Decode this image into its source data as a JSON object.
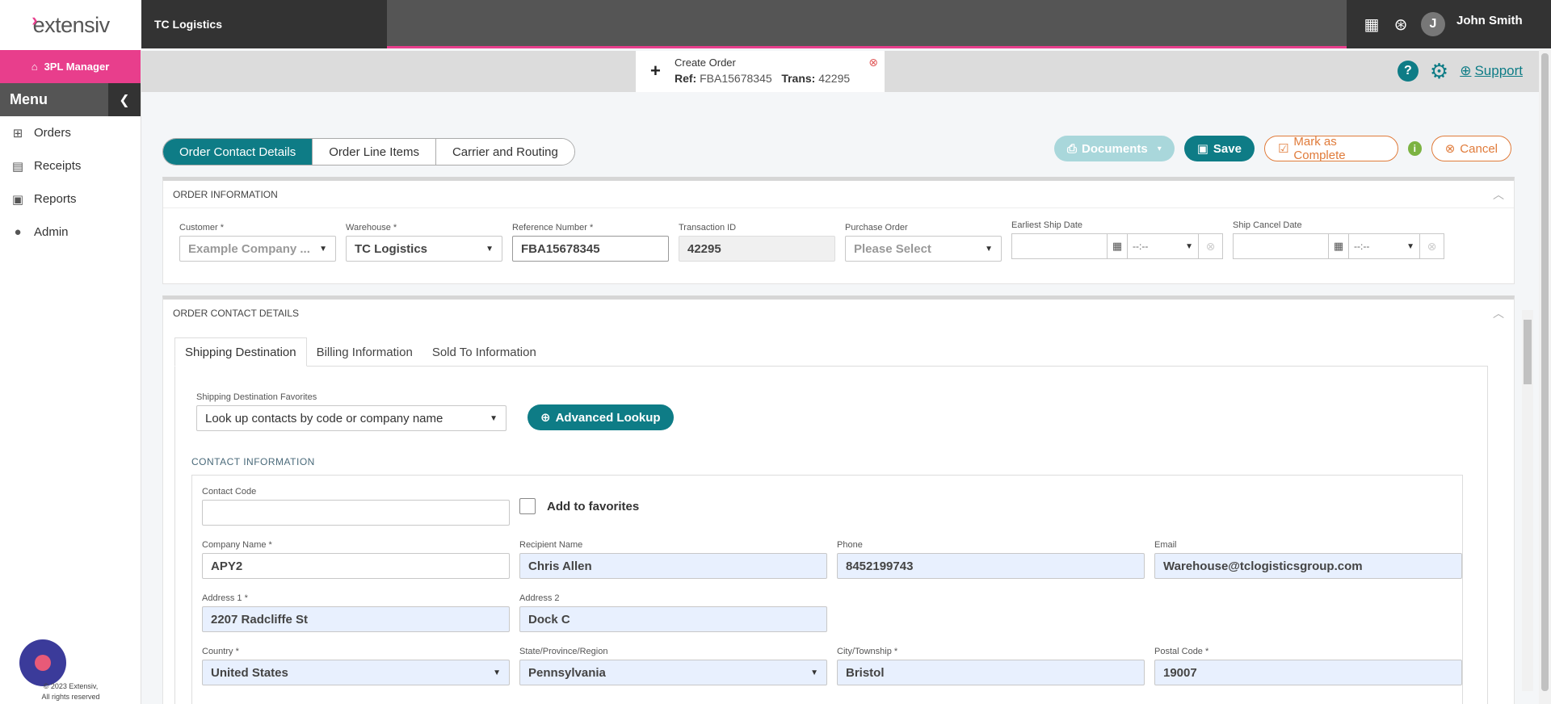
{
  "brand": {
    "logo": "extensiv",
    "org": "TC Logistics"
  },
  "user": {
    "initial": "J",
    "name": "John Smith"
  },
  "sidebar": {
    "manager": "3PL Manager",
    "menu_label": "Menu",
    "items": [
      {
        "label": "Orders",
        "icon": "sitemap-icon"
      },
      {
        "label": "Receipts",
        "icon": "document-icon"
      },
      {
        "label": "Reports",
        "icon": "report-icon"
      },
      {
        "label": "Admin",
        "icon": "user-icon"
      }
    ],
    "copyright_line1": "© 2023 Extensiv,",
    "copyright_line2": "All rights reserved"
  },
  "order_tab": {
    "title": "Create Order",
    "ref_label": "Ref:",
    "ref_value": "FBA15678345",
    "trans_label": "Trans:",
    "trans_value": "42295"
  },
  "support": {
    "label": "Support"
  },
  "wizard": {
    "tabs": [
      "Order Contact Details",
      "Order Line Items",
      "Carrier and Routing"
    ],
    "active": 0
  },
  "actions": {
    "documents": "Documents",
    "save": "Save",
    "mark_complete": "Mark as Complete",
    "cancel": "Cancel"
  },
  "order_info": {
    "title": "ORDER INFORMATION",
    "customer": {
      "label": "Customer *",
      "value": "Example Company ..."
    },
    "warehouse": {
      "label": "Warehouse *",
      "value": "TC Logistics"
    },
    "reference": {
      "label": "Reference Number *",
      "value": "FBA15678345"
    },
    "transaction": {
      "label": "Transaction ID",
      "value": "42295"
    },
    "purchase_order": {
      "label": "Purchase Order",
      "value": "Please Select"
    },
    "earliest_ship": {
      "label": "Earliest Ship Date",
      "time": "--:--"
    },
    "ship_cancel": {
      "label": "Ship Cancel Date",
      "time": "--:--"
    }
  },
  "contact_details": {
    "title": "ORDER CONTACT DETAILS",
    "tabs": [
      "Shipping Destination",
      "Billing Information",
      "Sold To Information"
    ],
    "favorites_label": "Shipping Destination Favorites",
    "favorites_value": "Look up contacts by code or company name",
    "advanced_lookup": "Advanced Lookup",
    "section_title": "CONTACT INFORMATION",
    "contact_code": {
      "label": "Contact Code",
      "value": ""
    },
    "add_favorites": "Add to favorites",
    "company_name": {
      "label": "Company Name *",
      "value": "APY2"
    },
    "recipient_name": {
      "label": "Recipient Name",
      "value": "Chris Allen"
    },
    "phone": {
      "label": "Phone",
      "value": "8452199743"
    },
    "email": {
      "label": "Email",
      "value": "Warehouse@tclogisticsgroup.com"
    },
    "address1": {
      "label": "Address 1 *",
      "value": "2207 Radcliffe St"
    },
    "address2": {
      "label": "Address 2",
      "value": "Dock C"
    },
    "country": {
      "label": "Country *",
      "value": "United States"
    },
    "state": {
      "label": "State/Province/Region",
      "value": "Pennsylvania"
    },
    "city": {
      "label": "City/Township *",
      "value": "Bristol"
    },
    "postal": {
      "label": "Postal Code *",
      "value": "19007"
    }
  }
}
